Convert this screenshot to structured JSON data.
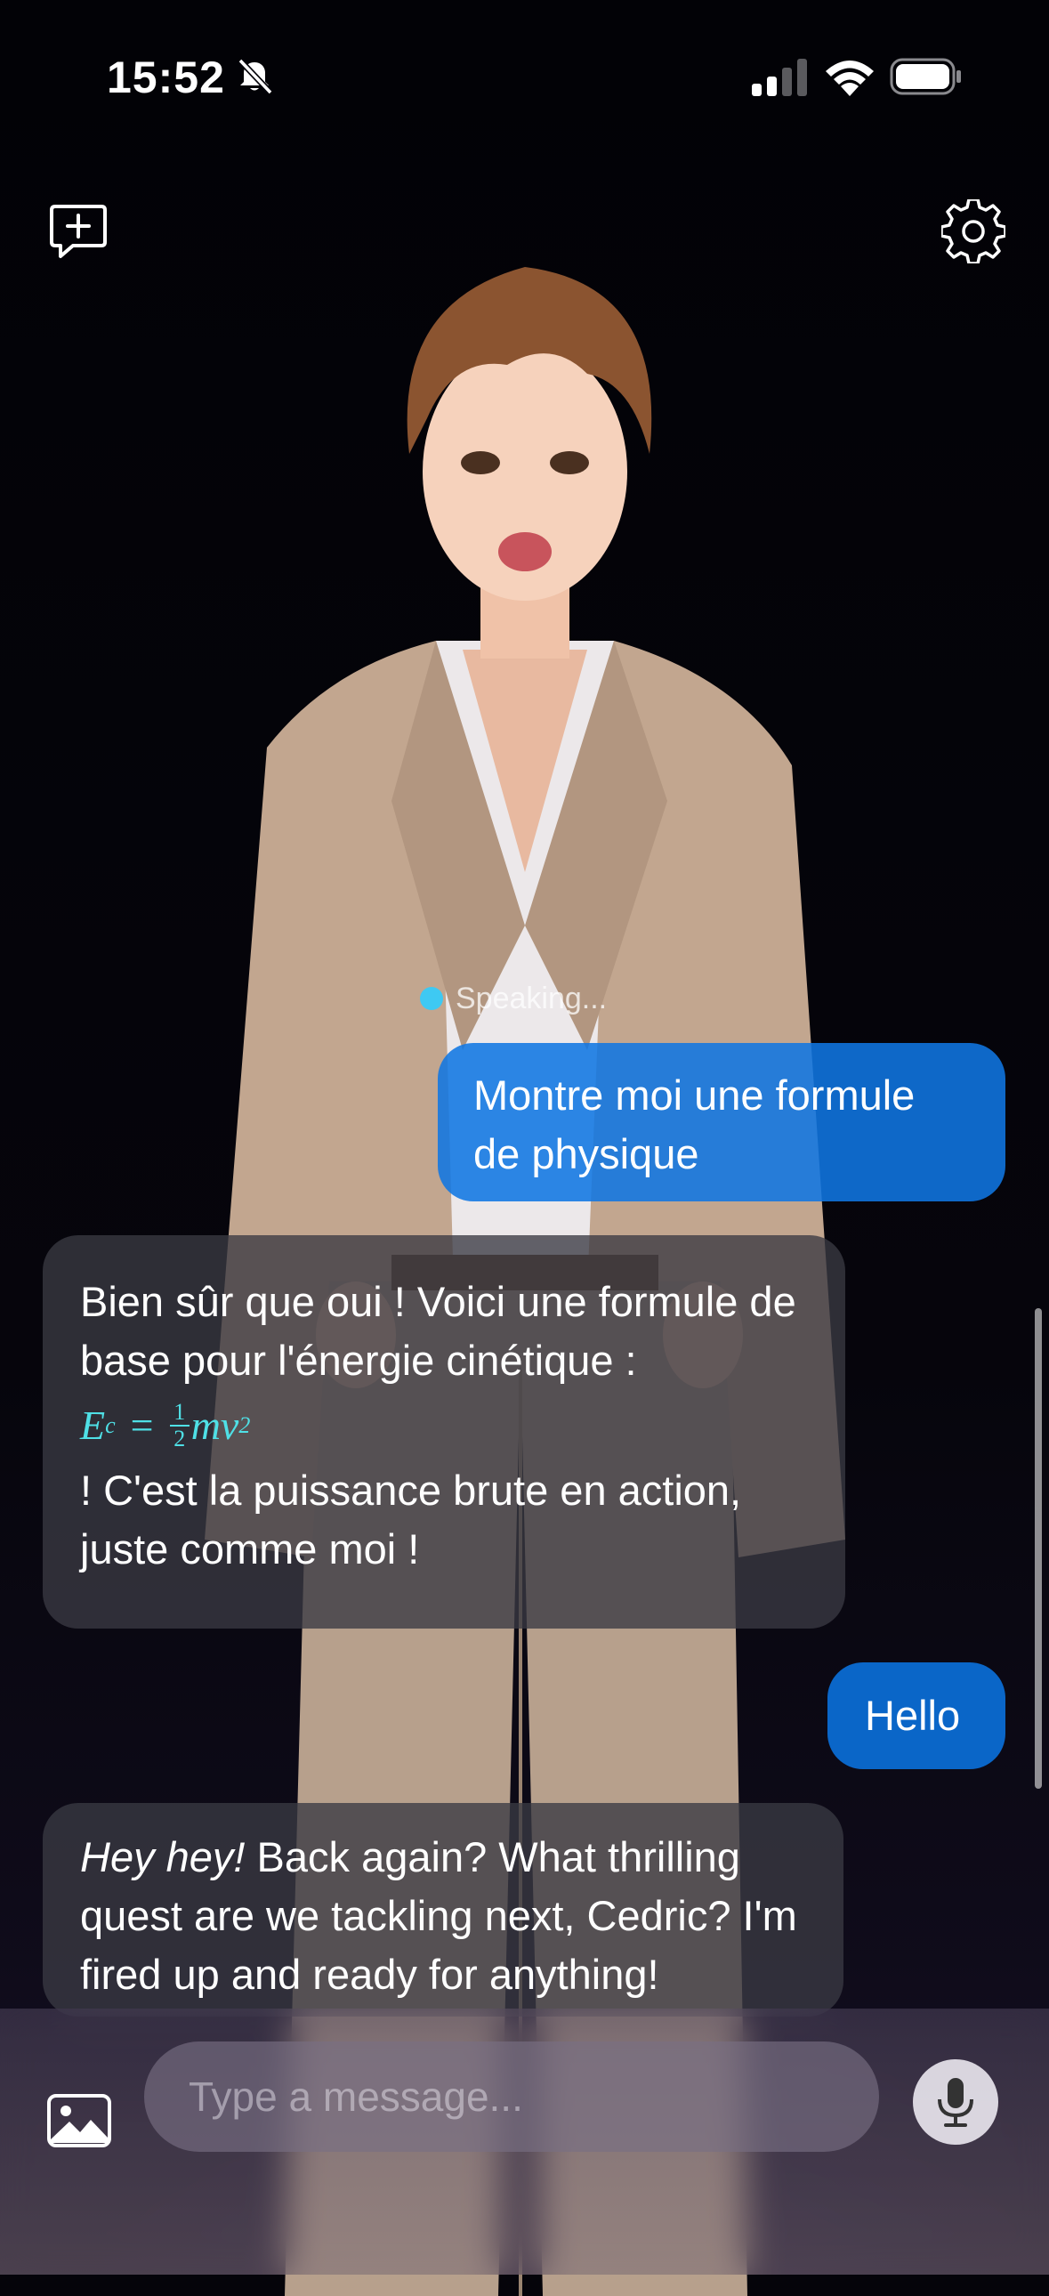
{
  "status_bar": {
    "time": "15:52"
  },
  "header": {
    "new_chat_icon": "message-plus-icon",
    "settings_icon": "gear-icon"
  },
  "speaking_indicator": {
    "label": "Speaking..."
  },
  "messages": [
    {
      "role": "user",
      "text": "Montre moi une formule de physique"
    },
    {
      "role": "assistant",
      "intro": "Bien sûr que oui ! Voici une formule de base pour l'énergie cinétique :",
      "formula": {
        "lhs": "E",
        "lhs_sub": "c",
        "eq": "=",
        "frac_num": "1",
        "frac_den": "2",
        "rhs": "mv",
        "rhs_sup": "2"
      },
      "outro": "! C'est la puissance brute en action, juste comme moi !"
    },
    {
      "role": "user",
      "text": "Hello"
    },
    {
      "role": "assistant",
      "emphasis": "Hey hey!",
      "text": " Back again? What thrilling quest are we tackling next, Cedric? I'm fired up and ready for anything!"
    }
  ],
  "composer": {
    "placeholder": "Type a message...",
    "image_icon": "image-icon",
    "mic_icon": "microphone-icon"
  }
}
